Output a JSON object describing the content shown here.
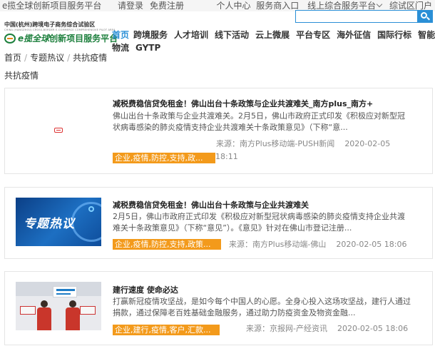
{
  "topbar": {
    "site_name": "e揽全球创新项目服务平台",
    "login": "请登录",
    "register": "免费注册",
    "user_center": "个人中心",
    "service_store": "服务商入口",
    "online_service": "线上综合服务平台",
    "gateway": "综试区门户"
  },
  "search": {
    "placeholder": ""
  },
  "logo": {
    "line1": "中国(杭州)跨境电子商务综合试验区",
    "line2": "CHINA (HANGZHOU) CROSS-BORDER E-COMMERCE COMPREHENSIVE PILOT AREA",
    "brand": "e揽全球",
    "brand_sub": "创新项目服务平台"
  },
  "nav": {
    "row1": [
      "首页",
      "跨境服务",
      "人才培训",
      "线下活动",
      "云上微展",
      "平台专区",
      "海外征信",
      "国际行标",
      "智能"
    ],
    "row2": [
      "物流",
      "GYTP"
    ]
  },
  "breadcrumb": {
    "home": "首页",
    "section": "专题热议",
    "current": "共抗疫情"
  },
  "page_title": "共抗疫情",
  "articles": [
    {
      "title": "减税费稳信贷免租金！佛山出台十条政策与企业共渡难关_南方plus_南方+",
      "desc": "佛山出台十条政策与企业共渡难关。2月5日，佛山市政府正式印发《积极应对新型冠状病毒感染的肺炎疫情支持企业共渡难关十条政策意见》（下称“意...",
      "source": "来源：南方Plus移动端-PUSH新闻",
      "date": "2020-02-05",
      "time": "18:11",
      "tags": "企业,疫情,防控,支持,政..."
    },
    {
      "title": "减税费稳信贷免租金！佛山出台十条政策与企业共渡难关",
      "desc": "2月5日，佛山市政府正式印发《积极应对新型冠状病毒感染的肺炎疫情支持企业共渡难关十条政策意见》（下称“意见”）。《意见》针对在佛山市登记注册...",
      "source": "来源：南方Plus移动端-佛山",
      "datetime": "2020-02-05 18:06",
      "tags": "企业,疫情,防控,支持,政策...",
      "thumb_text": "专题热议"
    },
    {
      "title": "建行速度 使命必达",
      "desc": "打赢新冠疫情攻坚战，是如今每个中国人的心愿。全身心投入这场攻坚战，建行人通过捐款，通过保障老百姓基础金融服务，通过助力防疫资金及物资金融...",
      "source": "来源：京报网-产经资讯",
      "datetime": "2020-02-05 18:06",
      "tags": "企业,建行,疫情,客户,汇款..."
    }
  ]
}
